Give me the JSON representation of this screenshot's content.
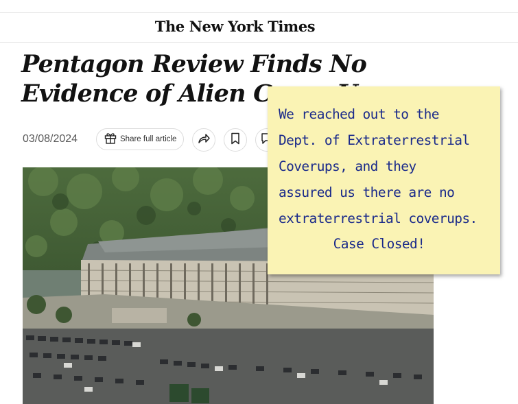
{
  "masthead": {
    "logo": "The New York Times"
  },
  "article": {
    "headline": "Pentagon Review Finds No Evidence of Alien Cover-Up",
    "date": "03/08/2024",
    "share_label": "Share full article"
  },
  "toolbar_icons": [
    "gift-icon",
    "share-arrow-icon",
    "bookmark-icon",
    "comment-icon"
  ],
  "photo": {
    "subject": "aerial-pentagon-photo"
  },
  "sticky_note": {
    "lines": [
      "We reached out to the",
      "Dept. of Extraterrestrial",
      "Coverups, and they",
      "assured us there are no",
      "extraterrestrial coverups."
    ],
    "closing": "Case Closed!"
  },
  "colors": {
    "note_bg": "#faf3b4",
    "note_text": "#1a2a8a"
  }
}
